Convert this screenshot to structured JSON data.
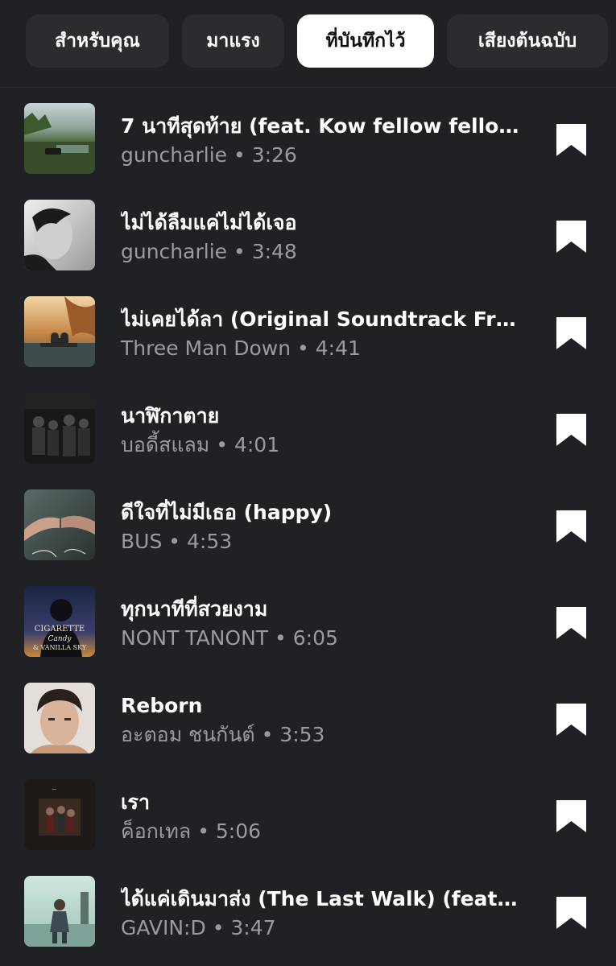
{
  "tabs": [
    {
      "label": "สำหรับคุณ",
      "active": false
    },
    {
      "label": "มาแรง",
      "active": false
    },
    {
      "label": "ที่บันทึกไว้",
      "active": true
    },
    {
      "label": "เสียงต้นฉบับ",
      "active": false
    }
  ],
  "meta_separator": "•",
  "songs": [
    {
      "title": "7 นาทีสุดท้าย (feat. Kow fellow fellow)",
      "artist": "guncharlie",
      "duration": "3:26",
      "bookmark_icon": "bookmark-filled-icon"
    },
    {
      "title": "ไม่ได้ลืมแค่ไม่ได้เจอ",
      "artist": "guncharlie",
      "duration": "3:48",
      "bookmark_icon": "bookmark-filled-icon"
    },
    {
      "title": "ไม่เคยได้ลา (Original Soundtrack Fro...",
      "artist": "Three Man Down",
      "duration": "4:41",
      "bookmark_icon": "bookmark-filled-icon"
    },
    {
      "title": "นาฬิกาตาย",
      "artist": "บอดี้สแลม",
      "duration": "4:01",
      "bookmark_icon": "bookmark-filled-icon"
    },
    {
      "title": "ดีใจที่ไม่มีเธอ (happy)",
      "artist": "BUS",
      "duration": "4:53",
      "bookmark_icon": "bookmark-filled-icon"
    },
    {
      "title": "ทุกนาทีที่สวยงาม",
      "artist": "NONT TANONT",
      "duration": "6:05",
      "bookmark_icon": "bookmark-filled-icon",
      "cover_text": [
        "CIGARETTE",
        "Candy",
        "& VANILLA SKY"
      ]
    },
    {
      "title": "Reborn",
      "artist": "อะตอม ชนกันต์",
      "duration": "3:53",
      "bookmark_icon": "bookmark-filled-icon"
    },
    {
      "title": "เรา",
      "artist": "ค็อกเทล",
      "duration": "5:06",
      "bookmark_icon": "bookmark-filled-icon"
    },
    {
      "title": "ได้แค่เดินมาส่ง (The Last Walk) (feat....",
      "artist": "GAVIN:D",
      "duration": "3:47",
      "bookmark_icon": "bookmark-filled-icon"
    }
  ],
  "colors": {
    "background": "#202125",
    "tab_background": "#2b2c30",
    "tab_active_background": "#ffffff",
    "title": "#ffffff",
    "meta": "#9a9ba1"
  }
}
